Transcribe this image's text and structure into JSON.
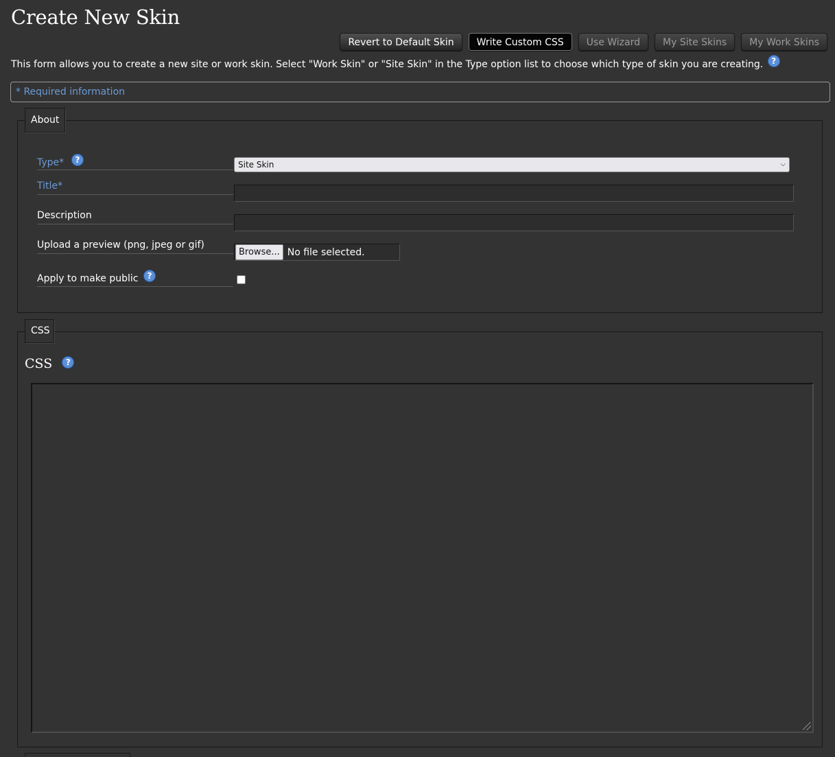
{
  "page": {
    "title": "Create New Skin"
  },
  "nav": {
    "revert_label": "Revert to Default Skin",
    "write_css_label": "Write Custom CSS",
    "wizard_label": "Use Wizard",
    "site_skins_label": "My Site Skins",
    "work_skins_label": "My Work Skins"
  },
  "intro": {
    "text": "This form allows you to create a new site or work skin. Select \"Work Skin\" or \"Site Skin\" in the Type option list to choose which type of skin you are creating."
  },
  "required_note": "* Required information",
  "about": {
    "legend": "About",
    "type_label": "Type*",
    "type_value": "Site Skin",
    "title_label": "Title*",
    "title_value": "",
    "description_label": "Description",
    "description_value": "",
    "upload_label": "Upload a preview (png, jpeg or gif)",
    "browse_label": "Browse...",
    "file_status": "No file selected.",
    "public_label": "Apply to make public",
    "public_checked": false
  },
  "css_section": {
    "legend": "CSS",
    "heading": "CSS",
    "value": ""
  },
  "icons": {
    "help": "question-mark-help-icon",
    "select_arrow": "chevron-down-icon",
    "resize": "resize-grip-icon"
  },
  "colors": {
    "background": "#333333",
    "link_blue": "#6c9bd6",
    "help_blue": "#5b8fd8"
  }
}
